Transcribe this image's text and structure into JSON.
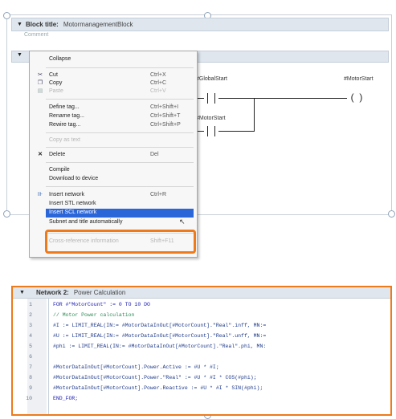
{
  "block": {
    "title_label": "Block title:",
    "title_value": "MotormanagementBlock",
    "comment": "Comment"
  },
  "ladder": {
    "contact1_tag": "#GlobalStart",
    "contact2_tag": "#MotorStart",
    "coil_tag": "#MotorStart"
  },
  "context_menu": {
    "items": [
      {
        "label": "Collapse",
        "shortcut": "",
        "icon": "",
        "enabled": true
      },
      {
        "label": "Cut",
        "shortcut": "Ctrl+X",
        "icon": "cut-icon",
        "enabled": true
      },
      {
        "label": "Copy",
        "shortcut": "Ctrl+C",
        "icon": "copy-icon",
        "enabled": true
      },
      {
        "label": "Paste",
        "shortcut": "Ctrl+V",
        "icon": "paste-icon",
        "enabled": false
      },
      {
        "label": "Define tag...",
        "shortcut": "Ctrl+Shift+I",
        "icon": "",
        "enabled": true
      },
      {
        "label": "Rename tag...",
        "shortcut": "Ctrl+Shift+T",
        "icon": "",
        "enabled": true
      },
      {
        "label": "Rewire tag...",
        "shortcut": "Ctrl+Shift+P",
        "icon": "",
        "enabled": true
      },
      {
        "label": "Copy as text",
        "shortcut": "",
        "icon": "",
        "enabled": false
      },
      {
        "label": "Delete",
        "shortcut": "Del",
        "icon": "delete-icon",
        "enabled": true
      },
      {
        "label": "Compile",
        "shortcut": "",
        "icon": "",
        "enabled": true
      },
      {
        "label": "Download to device",
        "shortcut": "",
        "icon": "",
        "enabled": true
      },
      {
        "label": "Insert network",
        "shortcut": "Ctrl+R",
        "icon": "insert-network-icon",
        "enabled": true
      },
      {
        "label": "Insert STL network",
        "shortcut": "",
        "icon": "",
        "enabled": true
      },
      {
        "label": "Insert SCL network",
        "shortcut": "",
        "icon": "",
        "enabled": true,
        "selected": true
      },
      {
        "label": "Subnet and title automatically",
        "shortcut": "",
        "icon": "",
        "enabled": true
      },
      {
        "label": "Cross-reference information",
        "shortcut": "Shift+F11",
        "icon": "",
        "enabled": false
      }
    ]
  },
  "network2": {
    "label": "Network 2:",
    "title": "Power Calculation",
    "code_lines": [
      {
        "n": "1",
        "text": "FOR #\"MotorCount\" := 0 TO 10 DO",
        "kind": "kw"
      },
      {
        "n": "2",
        "text": "    // Motor Power calculation",
        "kind": "cmt"
      },
      {
        "n": "3",
        "text": "    #I := LIMIT_REAL(IN:= #MotorDataInOut[#MotorCount].\"Real\".inff, MN:=",
        "kind": ""
      },
      {
        "n": "4",
        "text": "    #U := LIMIT_REAL(IN:= #MotorDataInOut[#MotorCount].\"Real\".unff, MN:=",
        "kind": ""
      },
      {
        "n": "5",
        "text": "    #phi := LIMIT_REAL(IN:= #MotorDataInOut[#MotorCount].\"Real\".phi, MN:",
        "kind": ""
      },
      {
        "n": "6",
        "text": "",
        "kind": ""
      },
      {
        "n": "7",
        "text": "    #MotorDataInOut[#MotorCount].Power.Active := #U * #I;",
        "kind": ""
      },
      {
        "n": "8",
        "text": "    #MotorDataInOut[#MotorCount].Power.\"Real\" := #U * #I * COS(#phi);",
        "kind": ""
      },
      {
        "n": "9",
        "text": "    #MotorDataInOut[#MotorCount].Power.Reactive := #U * #I * SIN(#phi);",
        "kind": ""
      },
      {
        "n": "10",
        "text": "END_FOR;",
        "kind": "kw"
      }
    ]
  },
  "colors": {
    "highlight_outline": "#ee7a1b",
    "menu_selection": "#2b66d9",
    "header_bg": "#dfe6ee"
  }
}
